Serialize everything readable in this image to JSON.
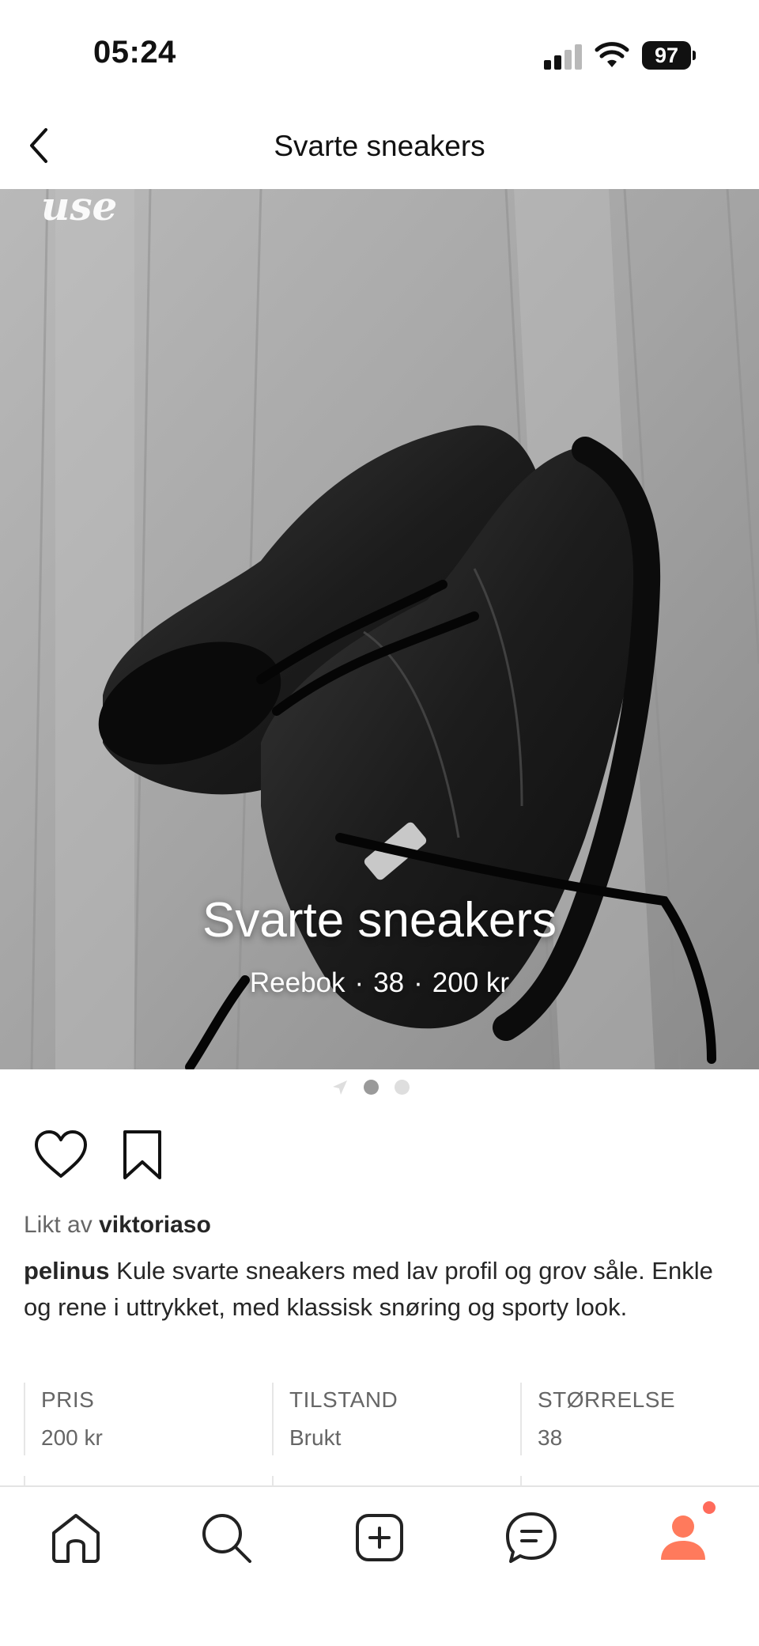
{
  "status_bar": {
    "time": "05:24",
    "battery": "97",
    "icons": [
      "cellular-signal-icon",
      "wifi-icon",
      "battery-icon"
    ]
  },
  "header": {
    "title": "Svarte sneakers",
    "back_icon": "chevron-left-icon"
  },
  "listing": {
    "image_watermark": "use",
    "overlay_title": "Svarte sneakers",
    "brand": "Reebok",
    "size": "38",
    "price": "200 kr",
    "separator": "·",
    "pager": {
      "pages": 2,
      "current": 1
    }
  },
  "actions": {
    "like_icon": "heart-icon",
    "save_icon": "bookmark-icon"
  },
  "likes": {
    "prefix": "Likt av",
    "user": "viktoriaso"
  },
  "caption": {
    "user": "pelinus",
    "text": "Kule svarte sneakers med lav profil og grov såle. Enkle og rene i uttrykket, med klassisk snøring og sporty look."
  },
  "details": [
    {
      "label": "PRIS",
      "value": "200 kr"
    },
    {
      "label": "TILSTAND",
      "value": "Brukt"
    },
    {
      "label": "STØRRELSE",
      "value": "38"
    }
  ],
  "tab_bar": {
    "tabs": [
      "home-icon",
      "search-icon",
      "add-icon",
      "messages-icon",
      "profile-icon"
    ],
    "active_color": "#ff7a5c",
    "has_notification": true
  },
  "colors": {
    "accent": "#ff7a5c",
    "text": "#262626",
    "muted": "#666666",
    "divider": "#e6e6e6"
  }
}
